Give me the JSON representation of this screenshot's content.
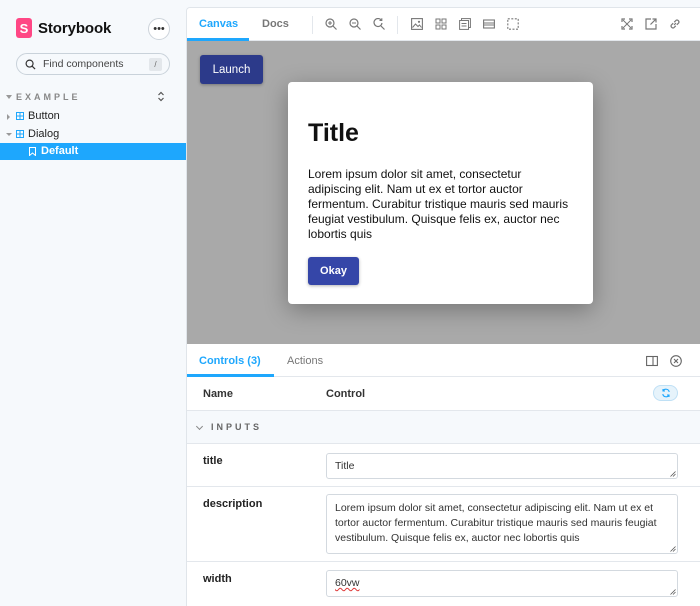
{
  "sidebar": {
    "brand": {
      "logo_letter": "S",
      "name": "Storybook"
    },
    "menu_label": "•••",
    "search": {
      "placeholder": "Find components",
      "shortcut": "/"
    },
    "section": {
      "label": "EXAMPLE",
      "updown": "⌃⌄"
    },
    "items": [
      {
        "label": "Button",
        "icon": "component-icon",
        "expanded": false
      },
      {
        "label": "Dialog",
        "icon": "component-icon",
        "expanded": true
      },
      {
        "label": "Default",
        "icon": "bookmark-icon",
        "selected": true
      }
    ]
  },
  "toolbar": {
    "tabs": [
      {
        "label": "Canvas",
        "active": true
      },
      {
        "label": "Docs",
        "active": false
      }
    ],
    "icons_left": [
      "zoom-in-icon",
      "zoom-out-icon",
      "zoom-reset-icon",
      "background-icon",
      "grid-icon",
      "measure-icon",
      "viewport-icon",
      "outline-icon"
    ],
    "icons_right": [
      "fullscreen-icon",
      "open-new-tab-icon",
      "copy-link-icon"
    ]
  },
  "canvas": {
    "launch_label": "Launch",
    "dialog": {
      "title": "Title",
      "description": "Lorem ipsum dolor sit amet, consectetur adipiscing elit. Nam ut ex et tortor auctor fermentum. Curabitur tristique mauris sed mauris feugiat vestibulum. Quisque felis ex, auctor nec lobortis quis",
      "okay_label": "Okay"
    }
  },
  "addons": {
    "tabs": [
      {
        "label": "Controls (3)",
        "active": true
      },
      {
        "label": "Actions",
        "active": false
      }
    ],
    "columns": {
      "name": "Name",
      "control": "Control"
    },
    "group_label": "INPUTS",
    "rows": [
      {
        "name": "title",
        "value": "Title"
      },
      {
        "name": "description",
        "value": "Lorem ipsum dolor sit amet, consectetur adipiscing elit. Nam ut ex et tortor auctor fermentum. Curabitur tristique mauris sed mauris feugiat vestibulum. Quisque felis ex, auctor nec lobortis quis"
      },
      {
        "name": "width",
        "value": "60vw"
      }
    ]
  },
  "colors": {
    "accent": "#1ea7fd",
    "brand": "#ff4785",
    "launch_button": "#2c3a8a",
    "okay_button": "#3546a8",
    "canvas_bg": "#a9a9a9"
  }
}
